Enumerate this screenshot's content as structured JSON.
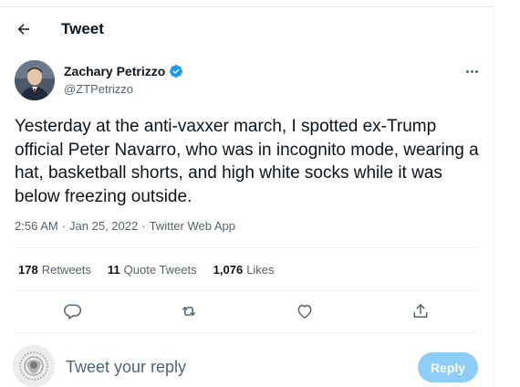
{
  "header": {
    "title": "Tweet"
  },
  "author": {
    "name": "Zachary Petrizzo",
    "handle": "@ZTPetrizzo",
    "verified": true
  },
  "tweet": {
    "text": "Yesterday at the anti-vaxxer march, I spotted ex-Trump official Peter Navarro, who was in incognito mode, wearing a hat, basketball shorts, and high white socks while it was below freezing outside.",
    "time": "2:56 AM",
    "date": "Jan 25, 2022",
    "source": "Twitter Web App",
    "sep": "·"
  },
  "stats": {
    "retweets_count": "178",
    "retweets_label": "Retweets",
    "quotes_count": "11",
    "quotes_label": "Quote Tweets",
    "likes_count": "1,076",
    "likes_label": "Likes"
  },
  "reply": {
    "placeholder": "Tweet your reply",
    "button_label": "Reply"
  },
  "colors": {
    "accent": "#1d9bf0",
    "reply_button_disabled": "#8ecdf8",
    "muted_text": "#536471"
  },
  "icons": [
    "back-arrow-icon",
    "verified-badge-icon",
    "more-icon",
    "reply-icon",
    "retweet-icon",
    "like-icon",
    "share-icon"
  ]
}
